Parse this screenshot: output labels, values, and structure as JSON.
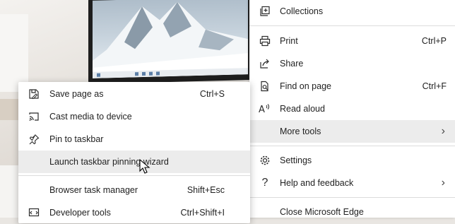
{
  "main_menu": {
    "items": [
      {
        "label": "Collections",
        "shortcut": "",
        "icon": "collections-icon"
      },
      {
        "label": "Print",
        "shortcut": "Ctrl+P",
        "icon": "print-icon"
      },
      {
        "label": "Share",
        "shortcut": "",
        "icon": "share-icon"
      },
      {
        "label": "Find on page",
        "shortcut": "Ctrl+F",
        "icon": "find-on-page-icon"
      },
      {
        "label": "Read aloud",
        "shortcut": "",
        "icon": "read-aloud-icon"
      },
      {
        "label": "More tools",
        "shortcut": "",
        "icon": "",
        "submenu": true
      },
      {
        "label": "Settings",
        "shortcut": "",
        "icon": "settings-icon"
      },
      {
        "label": "Help and feedback",
        "shortcut": "",
        "icon": "help-icon",
        "submenu": true
      },
      {
        "label": "Close Microsoft Edge",
        "shortcut": "",
        "icon": ""
      }
    ]
  },
  "more_tools_menu": {
    "items": [
      {
        "label": "Save page as",
        "shortcut": "Ctrl+S",
        "icon": "save-page-icon"
      },
      {
        "label": "Cast media to device",
        "shortcut": "",
        "icon": "cast-icon"
      },
      {
        "label": "Pin to taskbar",
        "shortcut": "",
        "icon": "pin-icon"
      },
      {
        "label": "Launch taskbar pinning wizard",
        "shortcut": "",
        "icon": ""
      },
      {
        "label": "Browser task manager",
        "shortcut": "Shift+Esc",
        "icon": ""
      },
      {
        "label": "Developer tools",
        "shortcut": "Ctrl+Shift+I",
        "icon": "developer-tools-icon"
      }
    ],
    "hovered_item": "Launch taskbar pinning wizard"
  },
  "colors": {
    "menu_bg": "#ffffff",
    "hover_bg": "#ececec",
    "separator": "#dcdcdc",
    "text": "#1f1f1f"
  }
}
